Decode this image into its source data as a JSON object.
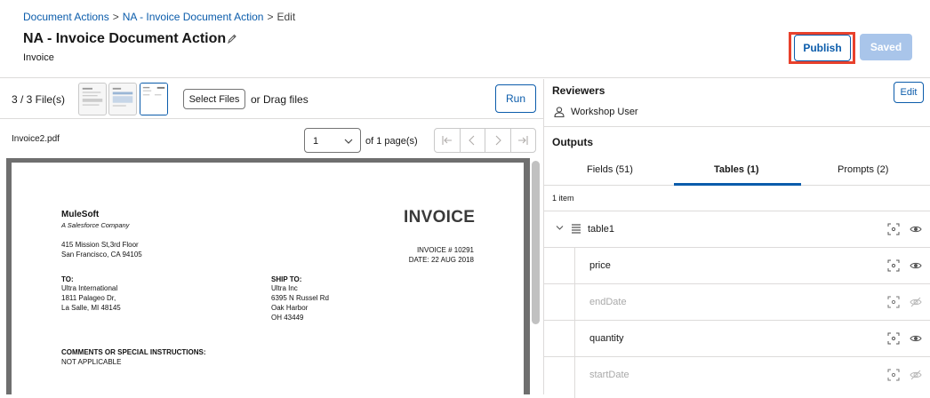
{
  "breadcrumbs": [
    {
      "label": "Document Actions",
      "link": true
    },
    {
      "label": "NA - Invoice Document Action",
      "link": true
    },
    {
      "label": "Edit",
      "link": false
    }
  ],
  "breadcrumb_separator": ">",
  "page": {
    "title": "NA - Invoice Document Action",
    "subtitle": "Invoice"
  },
  "actions": {
    "publish_label": "Publish",
    "saved_label": "Saved"
  },
  "files": {
    "count_label": "3 / 3 File(s)",
    "select_label": "Select Files",
    "drag_label": "or Drag files",
    "run_label": "Run",
    "current_file": "Invoice2.pdf",
    "page_value": "1",
    "page_total_label": "of 1 page(s)"
  },
  "document": {
    "company": "MuleSoft",
    "tagline": "A Salesforce Company",
    "address1": "415 Mission St,3rd Floor",
    "address2": "San Francisco, CA 94105",
    "heading": "INVOICE",
    "invoice_no": "INVOICE # 10291",
    "date": "DATE: 22 AUG 2018",
    "to_label": "TO:",
    "to_lines": [
      "Ultra International",
      "1811 Palageo Dr,",
      "La Salle, MI 48145"
    ],
    "ship_label": "SHIP TO:",
    "ship_lines": [
      "Ultra Inc",
      "6395 N Russel Rd",
      "Oak Harbor",
      "OH 43449"
    ],
    "comments_label": "COMMENTS OR SPECIAL INSTRUCTIONS:",
    "comments_value": "NOT APPLICABLE"
  },
  "reviewers": {
    "title": "Reviewers",
    "edit_label": "Edit",
    "user": "Workshop User"
  },
  "outputs": {
    "title": "Outputs",
    "tabs": [
      {
        "label": "Fields (51)",
        "active": false
      },
      {
        "label": "Tables (1)",
        "active": true
      },
      {
        "label": "Prompts (2)",
        "active": false
      }
    ],
    "count_label": "1 item",
    "rows": [
      {
        "label": "table1",
        "type": "table",
        "visible": true
      },
      {
        "label": "price",
        "type": "column",
        "visible": true
      },
      {
        "label": "endDate",
        "type": "column",
        "visible": false
      },
      {
        "label": "quantity",
        "type": "column",
        "visible": true
      },
      {
        "label": "startDate",
        "type": "column",
        "visible": false
      }
    ]
  },
  "colors": {
    "brand": "#0b5cab",
    "highlight_frame": "#e8412c",
    "saved_disabled": "#a9c5ea"
  }
}
